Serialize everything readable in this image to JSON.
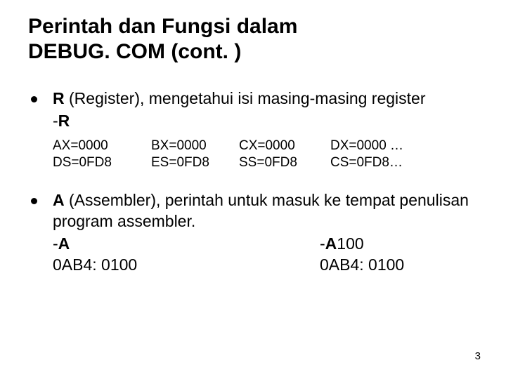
{
  "title_line1": "Perintah dan Fungsi dalam",
  "title_line2": "DEBUG. COM  (cont. )",
  "bullet1": {
    "text_prefix_bold": "R",
    "text_rest": " (Register), mengetahui isi masing-masing register",
    "minus_r": "-",
    "minus_r_bold": "R"
  },
  "registers": {
    "row1": {
      "c1": "AX=0000",
      "c2": "BX=0000",
      "c3": "CX=0000",
      "c4": "DX=0000  …"
    },
    "row2": {
      "c1": "DS=0FD8",
      "c2": "ES=0FD8",
      "c3": "SS=0FD8",
      "c4": "CS=0FD8…"
    }
  },
  "bullet2": {
    "text_prefix_bold": "A",
    "text_rest": " (Assembler), perintah untuk masuk ke tempat penulisan program assembler.",
    "rows": {
      "r1c1_prefix": "-",
      "r1c1_bold": "A",
      "r1c2_prefix": "-",
      "r1c2_bold": "A",
      "r1c2_rest": "100",
      "r2c1": "0AB4: 0100",
      "r2c2": "0AB4: 0100"
    }
  },
  "page_number": "3"
}
